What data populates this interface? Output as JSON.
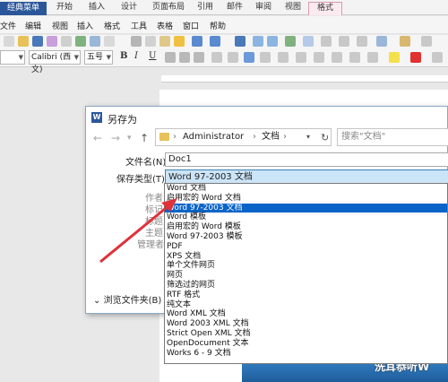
{
  "ribbon": {
    "tabs": [
      "经典菜单",
      "开始",
      "插入",
      "设计",
      "页面布局",
      "引用",
      "邮件",
      "审阅",
      "视图",
      "格式"
    ],
    "menu": [
      "文件",
      "编辑",
      "视图",
      "插入",
      "格式",
      "工具",
      "表格",
      "窗口",
      "帮助"
    ],
    "font_name": "Calibri (西文)",
    "font_size": "五号",
    "bold": "B",
    "italic": "I",
    "underline": "U"
  },
  "dialog": {
    "title": "另存为",
    "path": [
      "Administrator",
      "文档"
    ],
    "search_placeholder": "搜索\"文档\"",
    "file_name_label": "文件名(N):",
    "file_name_value": "Doc1",
    "file_type_label": "保存类型(T):",
    "file_type_value": "Word 97-2003 文档",
    "author_label": "作者:",
    "tags_label": "标记:",
    "title_label": "标题:",
    "subject_label": "主题:",
    "manager_label": "管理者:",
    "browse_folders": "浏览文件夹(B)"
  },
  "file_types": [
    "Word 文档",
    "启用宏的 Word 文档",
    "Word 97-2003 文档",
    "Word 模板",
    "启用宏的 Word 模板",
    "Word 97-2003 模板",
    "PDF",
    "XPS 文档",
    "单个文件网页",
    "网页",
    "筛选过的网页",
    "RTF 格式",
    "纯文本",
    "Word XML 文档",
    "Word 2003 XML 文档",
    "Strict Open XML 文档",
    "OpenDocument 文本",
    "Works 6 - 9 文档"
  ],
  "selected_file_type_index": 2,
  "watermark": "洗耳恭听W",
  "colors": {
    "accent": "#2b579a",
    "selection": "#0a64c8",
    "arrow": "#e0303a"
  }
}
